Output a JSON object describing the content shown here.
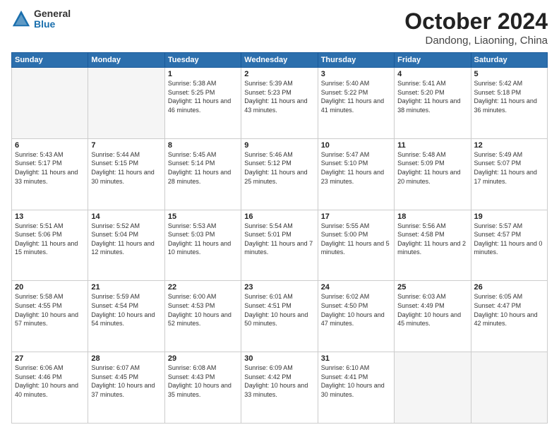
{
  "header": {
    "logo_general": "General",
    "logo_blue": "Blue",
    "month_title": "October 2024",
    "location": "Dandong, Liaoning, China"
  },
  "calendar": {
    "days_of_week": [
      "Sunday",
      "Monday",
      "Tuesday",
      "Wednesday",
      "Thursday",
      "Friday",
      "Saturday"
    ],
    "weeks": [
      [
        {
          "day": "",
          "sunrise": "",
          "sunset": "",
          "daylight": ""
        },
        {
          "day": "",
          "sunrise": "",
          "sunset": "",
          "daylight": ""
        },
        {
          "day": "1",
          "sunrise": "Sunrise: 5:38 AM",
          "sunset": "Sunset: 5:25 PM",
          "daylight": "Daylight: 11 hours and 46 minutes."
        },
        {
          "day": "2",
          "sunrise": "Sunrise: 5:39 AM",
          "sunset": "Sunset: 5:23 PM",
          "daylight": "Daylight: 11 hours and 43 minutes."
        },
        {
          "day": "3",
          "sunrise": "Sunrise: 5:40 AM",
          "sunset": "Sunset: 5:22 PM",
          "daylight": "Daylight: 11 hours and 41 minutes."
        },
        {
          "day": "4",
          "sunrise": "Sunrise: 5:41 AM",
          "sunset": "Sunset: 5:20 PM",
          "daylight": "Daylight: 11 hours and 38 minutes."
        },
        {
          "day": "5",
          "sunrise": "Sunrise: 5:42 AM",
          "sunset": "Sunset: 5:18 PM",
          "daylight": "Daylight: 11 hours and 36 minutes."
        }
      ],
      [
        {
          "day": "6",
          "sunrise": "Sunrise: 5:43 AM",
          "sunset": "Sunset: 5:17 PM",
          "daylight": "Daylight: 11 hours and 33 minutes."
        },
        {
          "day": "7",
          "sunrise": "Sunrise: 5:44 AM",
          "sunset": "Sunset: 5:15 PM",
          "daylight": "Daylight: 11 hours and 30 minutes."
        },
        {
          "day": "8",
          "sunrise": "Sunrise: 5:45 AM",
          "sunset": "Sunset: 5:14 PM",
          "daylight": "Daylight: 11 hours and 28 minutes."
        },
        {
          "day": "9",
          "sunrise": "Sunrise: 5:46 AM",
          "sunset": "Sunset: 5:12 PM",
          "daylight": "Daylight: 11 hours and 25 minutes."
        },
        {
          "day": "10",
          "sunrise": "Sunrise: 5:47 AM",
          "sunset": "Sunset: 5:10 PM",
          "daylight": "Daylight: 11 hours and 23 minutes."
        },
        {
          "day": "11",
          "sunrise": "Sunrise: 5:48 AM",
          "sunset": "Sunset: 5:09 PM",
          "daylight": "Daylight: 11 hours and 20 minutes."
        },
        {
          "day": "12",
          "sunrise": "Sunrise: 5:49 AM",
          "sunset": "Sunset: 5:07 PM",
          "daylight": "Daylight: 11 hours and 17 minutes."
        }
      ],
      [
        {
          "day": "13",
          "sunrise": "Sunrise: 5:51 AM",
          "sunset": "Sunset: 5:06 PM",
          "daylight": "Daylight: 11 hours and 15 minutes."
        },
        {
          "day": "14",
          "sunrise": "Sunrise: 5:52 AM",
          "sunset": "Sunset: 5:04 PM",
          "daylight": "Daylight: 11 hours and 12 minutes."
        },
        {
          "day": "15",
          "sunrise": "Sunrise: 5:53 AM",
          "sunset": "Sunset: 5:03 PM",
          "daylight": "Daylight: 11 hours and 10 minutes."
        },
        {
          "day": "16",
          "sunrise": "Sunrise: 5:54 AM",
          "sunset": "Sunset: 5:01 PM",
          "daylight": "Daylight: 11 hours and 7 minutes."
        },
        {
          "day": "17",
          "sunrise": "Sunrise: 5:55 AM",
          "sunset": "Sunset: 5:00 PM",
          "daylight": "Daylight: 11 hours and 5 minutes."
        },
        {
          "day": "18",
          "sunrise": "Sunrise: 5:56 AM",
          "sunset": "Sunset: 4:58 PM",
          "daylight": "Daylight: 11 hours and 2 minutes."
        },
        {
          "day": "19",
          "sunrise": "Sunrise: 5:57 AM",
          "sunset": "Sunset: 4:57 PM",
          "daylight": "Daylight: 11 hours and 0 minutes."
        }
      ],
      [
        {
          "day": "20",
          "sunrise": "Sunrise: 5:58 AM",
          "sunset": "Sunset: 4:55 PM",
          "daylight": "Daylight: 10 hours and 57 minutes."
        },
        {
          "day": "21",
          "sunrise": "Sunrise: 5:59 AM",
          "sunset": "Sunset: 4:54 PM",
          "daylight": "Daylight: 10 hours and 54 minutes."
        },
        {
          "day": "22",
          "sunrise": "Sunrise: 6:00 AM",
          "sunset": "Sunset: 4:53 PM",
          "daylight": "Daylight: 10 hours and 52 minutes."
        },
        {
          "day": "23",
          "sunrise": "Sunrise: 6:01 AM",
          "sunset": "Sunset: 4:51 PM",
          "daylight": "Daylight: 10 hours and 50 minutes."
        },
        {
          "day": "24",
          "sunrise": "Sunrise: 6:02 AM",
          "sunset": "Sunset: 4:50 PM",
          "daylight": "Daylight: 10 hours and 47 minutes."
        },
        {
          "day": "25",
          "sunrise": "Sunrise: 6:03 AM",
          "sunset": "Sunset: 4:49 PM",
          "daylight": "Daylight: 10 hours and 45 minutes."
        },
        {
          "day": "26",
          "sunrise": "Sunrise: 6:05 AM",
          "sunset": "Sunset: 4:47 PM",
          "daylight": "Daylight: 10 hours and 42 minutes."
        }
      ],
      [
        {
          "day": "27",
          "sunrise": "Sunrise: 6:06 AM",
          "sunset": "Sunset: 4:46 PM",
          "daylight": "Daylight: 10 hours and 40 minutes."
        },
        {
          "day": "28",
          "sunrise": "Sunrise: 6:07 AM",
          "sunset": "Sunset: 4:45 PM",
          "daylight": "Daylight: 10 hours and 37 minutes."
        },
        {
          "day": "29",
          "sunrise": "Sunrise: 6:08 AM",
          "sunset": "Sunset: 4:43 PM",
          "daylight": "Daylight: 10 hours and 35 minutes."
        },
        {
          "day": "30",
          "sunrise": "Sunrise: 6:09 AM",
          "sunset": "Sunset: 4:42 PM",
          "daylight": "Daylight: 10 hours and 33 minutes."
        },
        {
          "day": "31",
          "sunrise": "Sunrise: 6:10 AM",
          "sunset": "Sunset: 4:41 PM",
          "daylight": "Daylight: 10 hours and 30 minutes."
        },
        {
          "day": "",
          "sunrise": "",
          "sunset": "",
          "daylight": ""
        },
        {
          "day": "",
          "sunrise": "",
          "sunset": "",
          "daylight": ""
        }
      ]
    ]
  }
}
